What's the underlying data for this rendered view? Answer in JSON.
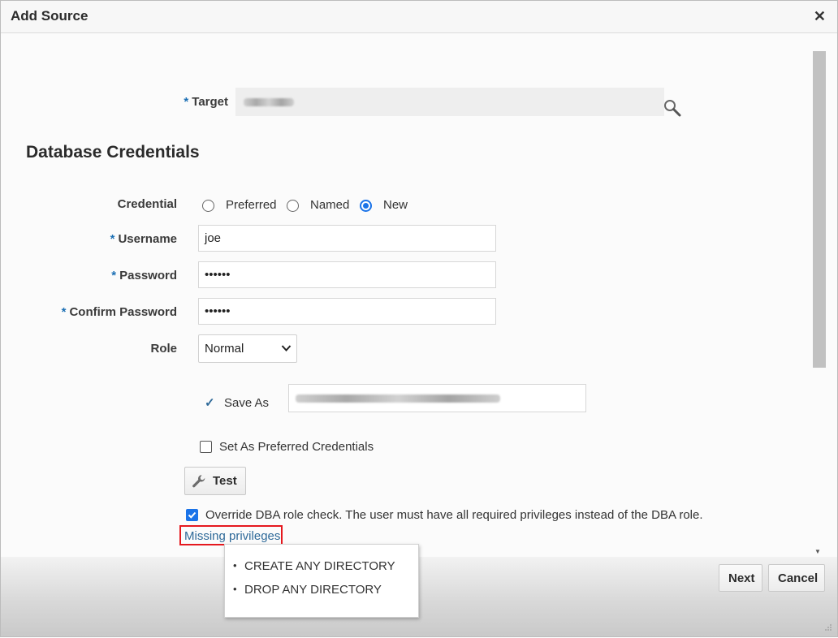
{
  "dialog": {
    "title": "Add Source",
    "close_icon": "close-icon"
  },
  "target": {
    "label": "Target",
    "required": "*",
    "value_obscured": true
  },
  "section": {
    "title": "Database Credentials"
  },
  "credential": {
    "label": "Credential",
    "options": [
      "Preferred",
      "Named",
      "New"
    ],
    "selected": "New"
  },
  "username": {
    "label": "Username",
    "required": "*",
    "value": "joe"
  },
  "password": {
    "label": "Password",
    "required": "*",
    "value": "••••••"
  },
  "confirm_password": {
    "label": "Confirm Password",
    "required": "*",
    "value": "••••••"
  },
  "role": {
    "label": "Role",
    "value": "Normal"
  },
  "save_as": {
    "mark": "✓",
    "label": "Save As",
    "value_obscured": true
  },
  "preferred": {
    "label": "Set As Preferred Credentials",
    "checked": false
  },
  "test_button": {
    "label": "Test",
    "icon": "wrench-icon"
  },
  "override": {
    "label": "Override DBA role check. The user must have all required privileges instead of the DBA role.",
    "checked": true
  },
  "missing_privileges": {
    "link": "Missing privileges",
    "items": [
      "CREATE ANY DIRECTORY",
      "DROP ANY DIRECTORY"
    ]
  },
  "footer": {
    "next_label": "Next",
    "cancel_label": "Cancel"
  },
  "colors": {
    "accent": "#1a73e8",
    "highlight": "#e5181e",
    "link": "#2f6a99"
  }
}
